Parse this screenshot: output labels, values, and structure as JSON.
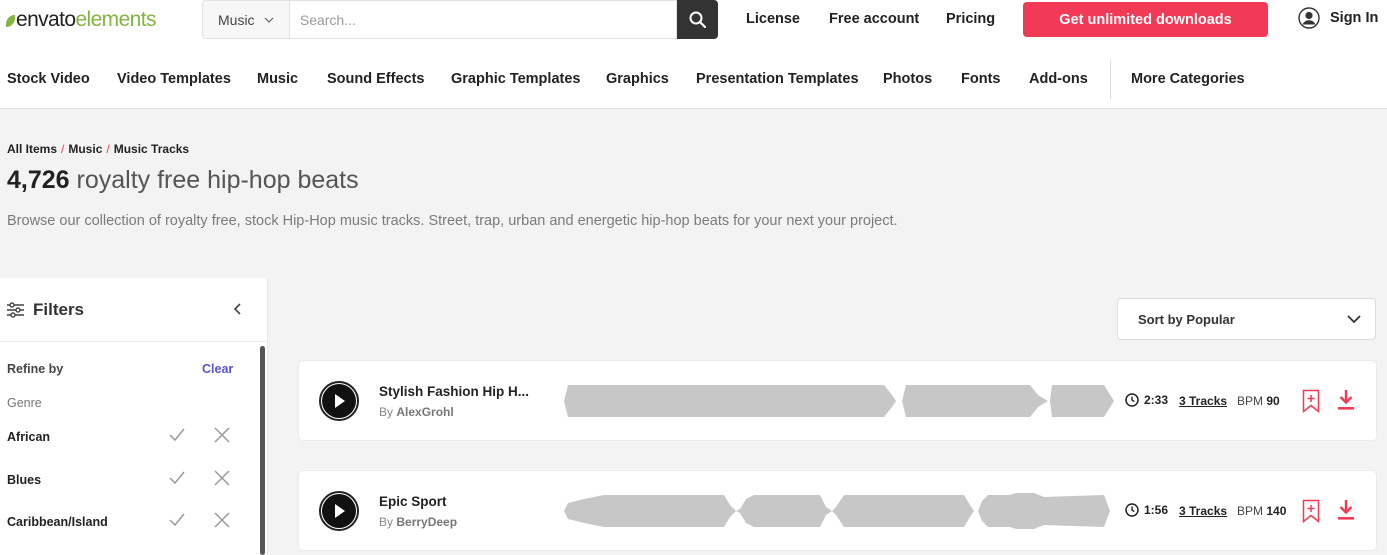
{
  "brand": {
    "name_part1": "envato",
    "name_part2": "elements",
    "accent": "#82b541"
  },
  "search": {
    "category": "Music",
    "placeholder": "Search..."
  },
  "topnav": {
    "license": "License",
    "free_account": "Free account",
    "pricing": "Pricing",
    "cta": "Get unlimited downloads",
    "sign_in": "Sign In",
    "cta_color": "#f23a56"
  },
  "categories": [
    "Stock Video",
    "Video Templates",
    "Music",
    "Sound Effects",
    "Graphic Templates",
    "Graphics",
    "Presentation Templates",
    "Photos",
    "Fonts",
    "Add-ons",
    "More Categories"
  ],
  "breadcrumb": [
    "All Items",
    "Music",
    "Music Tracks"
  ],
  "heading": {
    "count": "4,726",
    "text": "royalty free hip-hop beats"
  },
  "description": "Browse our collection of royalty free, stock Hip-Hop music tracks. Street, trap, urban and energetic hip-hop beats for your next your project.",
  "filters": {
    "title": "Filters",
    "refine_by": "Refine by",
    "clear": "Clear",
    "genre_label": "Genre",
    "genres": [
      "African",
      "Blues",
      "Caribbean/Island"
    ]
  },
  "sort": {
    "label": "Sort by Popular"
  },
  "tracks": [
    {
      "title": "Stylish Fashion Hip H...",
      "by": "By",
      "author": "AlexGrohl",
      "duration": "2:33",
      "tracks": "3 Tracks",
      "bpm_label": "BPM",
      "bpm": "90"
    },
    {
      "title": "Epic Sport",
      "by": "By",
      "author": "BerryDeep",
      "duration": "1:56",
      "tracks": "3 Tracks",
      "bpm_label": "BPM",
      "bpm": "140"
    }
  ]
}
